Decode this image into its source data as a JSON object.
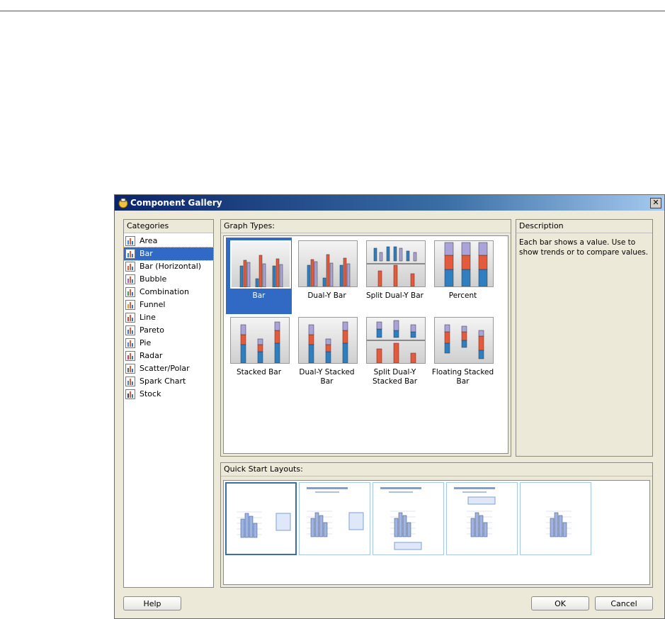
{
  "window": {
    "title": "Component Gallery",
    "close_label": "✕"
  },
  "categories": {
    "header": "Categories",
    "items": [
      {
        "label": "Area",
        "icon": "area-chart-icon"
      },
      {
        "label": "Bar",
        "icon": "bar-chart-icon",
        "selected": true
      },
      {
        "label": "Bar (Horizontal)",
        "icon": "horizontal-bar-chart-icon"
      },
      {
        "label": "Bubble",
        "icon": "bubble-chart-icon"
      },
      {
        "label": "Combination",
        "icon": "combination-chart-icon"
      },
      {
        "label": "Funnel",
        "icon": "funnel-chart-icon"
      },
      {
        "label": "Line",
        "icon": "line-chart-icon"
      },
      {
        "label": "Pareto",
        "icon": "pareto-chart-icon"
      },
      {
        "label": "Pie",
        "icon": "pie-chart-icon"
      },
      {
        "label": "Radar",
        "icon": "radar-chart-icon"
      },
      {
        "label": "Scatter/Polar",
        "icon": "scatter-chart-icon"
      },
      {
        "label": "Spark Chart",
        "icon": "spark-chart-icon"
      },
      {
        "label": "Stock",
        "icon": "stock-chart-icon"
      }
    ]
  },
  "graph_types": {
    "header": "Graph Types:",
    "items": [
      {
        "label": "Bar",
        "selected": true
      },
      {
        "label": "Dual-Y Bar"
      },
      {
        "label": "Split Dual-Y Bar"
      },
      {
        "label": "Percent"
      },
      {
        "label": "Stacked Bar"
      },
      {
        "label": "Dual-Y Stacked Bar"
      },
      {
        "label": "Split Dual-Y Stacked Bar"
      },
      {
        "label": "Floating Stacked Bar"
      }
    ]
  },
  "description": {
    "header": "Description",
    "text": "Each bar shows a value. Use to show trends or to compare values."
  },
  "quick_start": {
    "header": "Quick Start Layouts:",
    "count": 5
  },
  "buttons": {
    "help": "Help",
    "ok": "OK",
    "cancel": "Cancel"
  },
  "colors": {
    "blue_bar": "#2f7fc0",
    "red_bar": "#e55a3c",
    "purple_bar": "#a9a3d8",
    "selection": "#316ac5"
  }
}
